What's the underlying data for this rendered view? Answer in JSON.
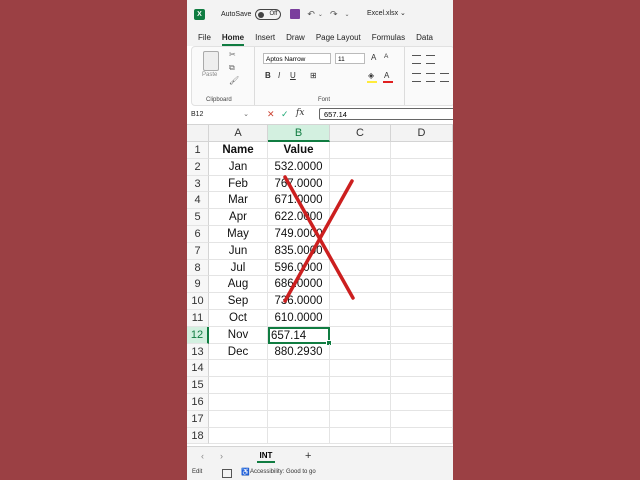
{
  "titlebar": {
    "logo": "X",
    "autosave_label": "AutoSave",
    "toggle_state": "Off",
    "filename": "Excel.xlsx ⌄"
  },
  "menu": {
    "tabs": [
      "File",
      "Home",
      "Insert",
      "Draw",
      "Page Layout",
      "Formulas",
      "Data"
    ],
    "active": "Home"
  },
  "ribbon": {
    "paste_label": "Paste",
    "clipboard_label": "Clipboard",
    "font_label": "Font",
    "font_name": "Aptos Narrow",
    "font_size": "11",
    "bold": "B",
    "italic": "I",
    "underline": "U",
    "fill_color": "#ffeb3b",
    "font_color": "#e02020"
  },
  "formula_bar": {
    "cell_ref": "B12",
    "value": "657.14"
  },
  "columns": [
    "A",
    "B",
    "C",
    "D"
  ],
  "selected_column": "B",
  "selected_row": 12,
  "rows": [
    {
      "n": "1",
      "a": "Name",
      "b": "Value",
      "header": true
    },
    {
      "n": "2",
      "a": "Jan",
      "b": "532.0000"
    },
    {
      "n": "3",
      "a": "Feb",
      "b": "767.0000"
    },
    {
      "n": "4",
      "a": "Mar",
      "b": "671.0000"
    },
    {
      "n": "5",
      "a": "Apr",
      "b": "622.0000"
    },
    {
      "n": "6",
      "a": "May",
      "b": "749.0000"
    },
    {
      "n": "7",
      "a": "Jun",
      "b": "835.0000"
    },
    {
      "n": "8",
      "a": "Jul",
      "b": "596.0000"
    },
    {
      "n": "9",
      "a": "Aug",
      "b": "686.0000"
    },
    {
      "n": "10",
      "a": "Sep",
      "b": "736.0000"
    },
    {
      "n": "11",
      "a": "Oct",
      "b": "610.0000"
    },
    {
      "n": "12",
      "a": "Nov",
      "b": "657.14",
      "active": true
    },
    {
      "n": "13",
      "a": "Dec",
      "b": "880.2930"
    },
    {
      "n": "14",
      "a": "",
      "b": ""
    },
    {
      "n": "15",
      "a": "",
      "b": ""
    },
    {
      "n": "16",
      "a": "",
      "b": ""
    },
    {
      "n": "17",
      "a": "",
      "b": ""
    },
    {
      "n": "18",
      "a": "",
      "b": ""
    }
  ],
  "overlay": {
    "type": "red-x",
    "color": "#cc1f1f"
  },
  "sheets": {
    "tabs": [
      "INT"
    ],
    "active": "INT",
    "add_label": "+"
  },
  "status": {
    "mode": "Edit",
    "accessibility": "Accessibility: Good to go"
  },
  "colors": {
    "accent": "#107c41",
    "background": "#9b4044"
  }
}
